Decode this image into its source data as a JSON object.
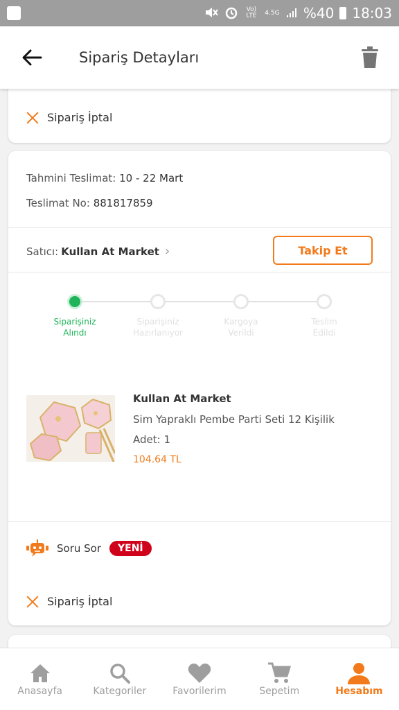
{
  "status_bar": {
    "volte": "Vo) LTE",
    "network": "4.5G",
    "battery": "%40",
    "time": "18:03"
  },
  "header": {
    "title": "Sipariş Detayları"
  },
  "top_card": {
    "cancel_label": "Sipariş İptal"
  },
  "order": {
    "delivery_label": "Tahmini Teslimat:",
    "delivery_value": "10 - 22 Mart",
    "tracking_label": "Teslimat No:",
    "tracking_value": "881817859",
    "seller_label": "Satıcı:",
    "seller_name": "Kullan At Market",
    "follow_label": "Takip Et"
  },
  "steps": [
    {
      "line1": "Siparişiniz",
      "line2": "Alındı",
      "active": true
    },
    {
      "line1": "Siparişiniz",
      "line2": "Hazırlanıyor",
      "active": false
    },
    {
      "line1": "Kargoya",
      "line2": "Verildi",
      "active": false
    },
    {
      "line1": "Teslim",
      "line2": "Edildi",
      "active": false
    }
  ],
  "product": {
    "seller": "Kullan At Market",
    "name": "Sim Yapraklı Pembe Parti Seti 12 Kişilik",
    "quantity": "Adet: 1",
    "price": "104.64 TL"
  },
  "ask": {
    "label": "Soru Sor",
    "badge": "YENİ"
  },
  "bottom_cancel_label": "Sipariş İptal",
  "nav": {
    "home": "Anasayfa",
    "categories": "Kategoriler",
    "favorites": "Favorilerim",
    "cart": "Sepetim",
    "account": "Hesabım"
  },
  "colors": {
    "accent": "#f27a1a",
    "success": "#1fb45a",
    "badge": "#d0021b"
  }
}
